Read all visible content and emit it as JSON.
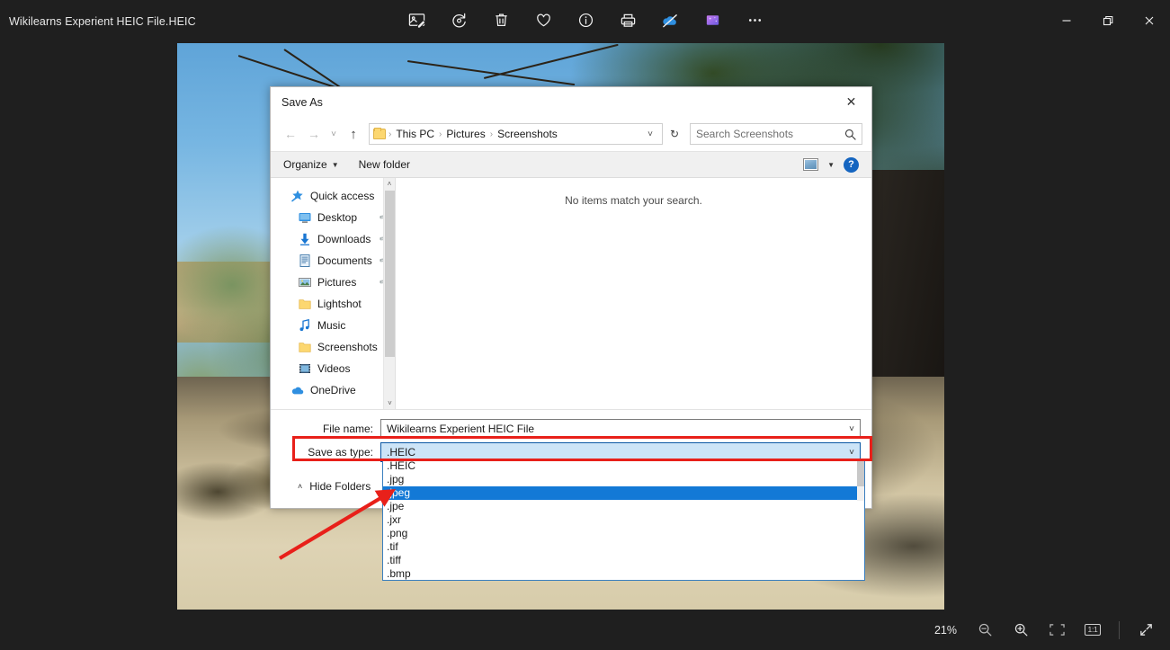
{
  "app": {
    "title": "Wikilearns Experient HEIC File.HEIC",
    "toolbar": [
      {
        "name": "edit-image-icon",
        "label": "Edit image"
      },
      {
        "name": "rotate-icon",
        "label": "Rotate"
      },
      {
        "name": "delete-icon",
        "label": "Delete"
      },
      {
        "name": "favorite-heart-icon",
        "label": "Add to favorites"
      },
      {
        "name": "info-icon",
        "label": "File info"
      },
      {
        "name": "print-icon",
        "label": "Print"
      },
      {
        "name": "onedrive-off-icon",
        "label": "OneDrive not syncing"
      },
      {
        "name": "designer-icon",
        "label": "Create with Designer"
      },
      {
        "name": "more-options-icon",
        "label": "See more"
      }
    ],
    "window_controls": [
      {
        "name": "minimize-button",
        "glyph": "—"
      },
      {
        "name": "restore-button",
        "glyph": "❐"
      },
      {
        "name": "close-button",
        "glyph": "✕"
      }
    ]
  },
  "statusbar": {
    "zoom_level": "21%",
    "buttons": [
      {
        "name": "zoom-out-button",
        "label": "Zoom out"
      },
      {
        "name": "zoom-in-button",
        "label": "Zoom in"
      },
      {
        "name": "fit-to-window-button",
        "label": "Fit to window"
      },
      {
        "name": "actual-size-button",
        "label": "1:1"
      },
      {
        "name": "fullscreen-button",
        "label": "Full screen"
      }
    ],
    "actual_size_label": "1:1"
  },
  "dialog": {
    "title": "Save As",
    "close_label": "✕",
    "nav": {
      "back_label": "←",
      "forward_label": "→",
      "recent_label": "˅",
      "up_label": "↑",
      "refresh_label": "↻",
      "breadcrumb": [
        "This PC",
        "Pictures",
        "Screenshots"
      ],
      "breadcrumb_sep": "›",
      "breadcrumb_chevron": "˅"
    },
    "search": {
      "placeholder": "Search Screenshots",
      "icon": "search-icon"
    },
    "command_bar": {
      "organize": "Organize",
      "organize_caret": "▼",
      "new_folder": "New folder",
      "view_caret": "▼",
      "help": "?"
    },
    "sidebar": {
      "items": [
        {
          "label": "Quick access",
          "icon": "quick-access-star-icon",
          "level": "root",
          "pinned": false
        },
        {
          "label": "Desktop",
          "icon": "desktop-icon",
          "level": "child",
          "pinned": true
        },
        {
          "label": "Downloads",
          "icon": "downloads-icon",
          "level": "child",
          "pinned": true
        },
        {
          "label": "Documents",
          "icon": "documents-icon",
          "level": "child",
          "pinned": true
        },
        {
          "label": "Pictures",
          "icon": "pictures-icon",
          "level": "child",
          "pinned": true
        },
        {
          "label": "Lightshot",
          "icon": "folder-icon",
          "level": "child",
          "pinned": false
        },
        {
          "label": "Music",
          "icon": "music-note-icon",
          "level": "child",
          "pinned": false
        },
        {
          "label": "Screenshots",
          "icon": "folder-icon",
          "level": "child",
          "pinned": false
        },
        {
          "label": "Videos",
          "icon": "videos-icon",
          "level": "child",
          "pinned": false
        },
        {
          "label": "OneDrive",
          "icon": "onedrive-cloud-icon",
          "level": "root",
          "pinned": false
        }
      ],
      "scroll_up": "˄",
      "scroll_down": "˅"
    },
    "file_list": {
      "empty_message": "No items match your search."
    },
    "fields": {
      "file_name_label": "File name:",
      "file_name_value": "Wikilearns Experient HEIC File",
      "save_as_type_label": "Save as type:",
      "save_as_type_value": ".HEIC",
      "chevron": "˅"
    },
    "hide_folders": {
      "label": "Hide Folders",
      "chevron": "˄"
    },
    "type_dropdown": {
      "options": [
        ".HEIC",
        ".jpg",
        ".jpeg",
        ".jpe",
        ".jxr",
        ".png",
        ".tif",
        ".tiff",
        ".bmp"
      ],
      "selected": ".jpeg"
    },
    "annotations": {
      "highlight_color": "#e8201a",
      "arrow_color": "#e8201a",
      "arrow_target": ".jpeg"
    }
  },
  "colors": {
    "app_background": "#1f1f1f",
    "dialog_background": "#ffffff",
    "selection_blue": "#1379d6",
    "focus_field_blue": "#cce4f7",
    "accent_red": "#e8201a"
  }
}
